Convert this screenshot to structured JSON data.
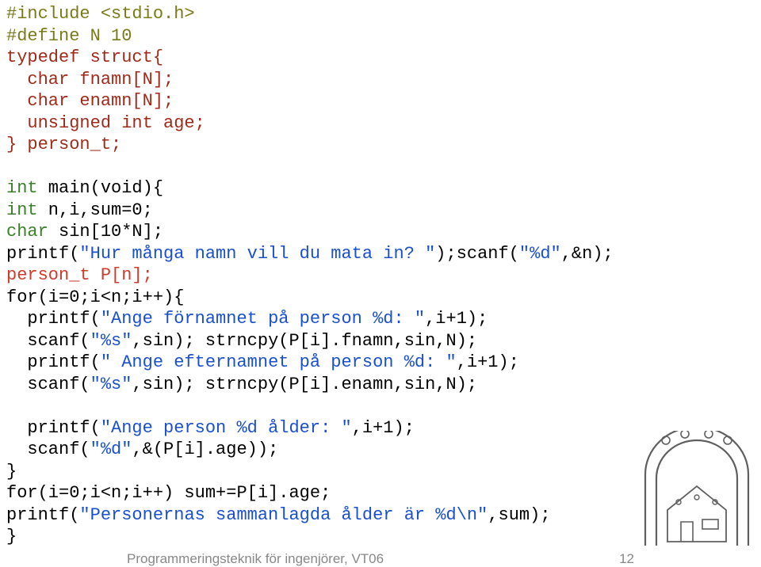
{
  "code": {
    "l01": "#include <stdio.h>",
    "l02": "#define N 10",
    "l03": "typedef struct{",
    "l04": "  char fnamn[N];",
    "l05": "  char enamn[N];",
    "l06": "  unsigned int age;",
    "l07": "} person_t;",
    "l08": "",
    "l09a": "int",
    "l09b": " main(void){",
    "l10a": "int",
    "l10b": " n,i,sum=0;",
    "l11a": "char",
    "l11b": " sin[10*N];",
    "l12a": "printf(",
    "l12b": "\"Hur många namn vill du mata in? \"",
    "l12c": ");scanf(",
    "l12d": "\"%d\"",
    "l12e": ",&n);",
    "l13": "person_t P[n];",
    "l14": "for(i=0;i<n;i++){",
    "l15a": "  printf(",
    "l15b": "\"Ange förnamnet på person %d: \"",
    "l15c": ",i+1);",
    "l16a": "  scanf(",
    "l16b": "\"%s\"",
    "l16c": ",sin); strncpy(P[i].fnamn,sin,N);",
    "l17a": "  printf(",
    "l17b": "\" Ange efternamnet på person %d: \"",
    "l17c": ",i+1);",
    "l18a": "  scanf(",
    "l18b": "\"%s\"",
    "l18c": ",sin); strncpy(P[i].enamn,sin,N);",
    "l19": "",
    "l20a": "  printf(",
    "l20b": "\"Ange person %d ålder: \"",
    "l20c": ",i+1);",
    "l21a": "  scanf(",
    "l21b": "\"%d\"",
    "l21c": ",&(P[i].age));",
    "l22": "}",
    "l23": "for(i=0;i<n;i++) sum+=P[i].age;",
    "l24a": "printf(",
    "l24b": "\"Personernas sammanlagda ålder är %d\\n\"",
    "l24c": ",sum);",
    "l25": "}"
  },
  "footer": {
    "title": "Programmeringsteknik för ingenjörer, VT06",
    "page": "12"
  }
}
